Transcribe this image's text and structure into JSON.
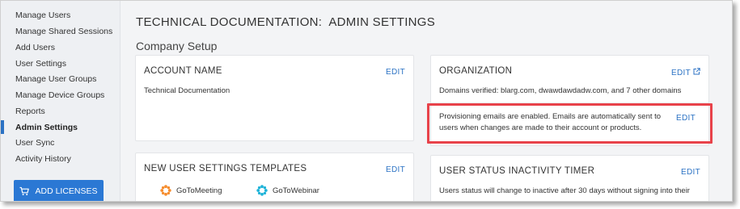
{
  "sidebar": {
    "items": [
      {
        "label": "Manage Users"
      },
      {
        "label": "Manage Shared Sessions"
      },
      {
        "label": "Add Users"
      },
      {
        "label": "User Settings"
      },
      {
        "label": "Manage User Groups"
      },
      {
        "label": "Manage Device Groups"
      },
      {
        "label": "Reports"
      },
      {
        "label": "Admin Settings"
      },
      {
        "label": "User Sync"
      },
      {
        "label": "Activity History"
      }
    ],
    "active_item": "Admin Settings",
    "add_licenses_label": "ADD LICENSES",
    "cart_icon": "cart-icon"
  },
  "header": {
    "title": "TECHNICAL DOCUMENTATION:  ADMIN SETTINGS",
    "section": "Company Setup"
  },
  "cards": {
    "account_name": {
      "title": "ACCOUNT NAME",
      "edit": "EDIT",
      "value": "Technical Documentation"
    },
    "organization": {
      "title": "ORGANIZATION",
      "edit": "EDIT",
      "external_icon": "external-link-icon",
      "domains": "Domains verified: blarg.com, dwawdawdadw.com, and 7 other domains",
      "provisioning_line1": "Provisioning emails are enabled. Emails are automatically sent to",
      "provisioning_line2": "users when changes are made to their account or products.",
      "provisioning_edit": "EDIT"
    },
    "templates": {
      "title": "NEW USER SETTINGS TEMPLATES",
      "edit": "EDIT",
      "products": [
        {
          "name": "GoToMeeting",
          "icon": "gotomeeting-icon",
          "color": "#f68d2e"
        },
        {
          "name": "GoToWebinar",
          "icon": "gotowebinar-icon",
          "color": "#1fb3d8"
        }
      ]
    },
    "inactivity": {
      "title": "USER STATUS INACTIVITY TIMER",
      "edit": "EDIT",
      "text": "Users status will change to inactive after 30 days without signing into their"
    }
  },
  "colors": {
    "accent": "#2b72c4",
    "button": "#2b78d4",
    "highlight": "#e8424a"
  }
}
